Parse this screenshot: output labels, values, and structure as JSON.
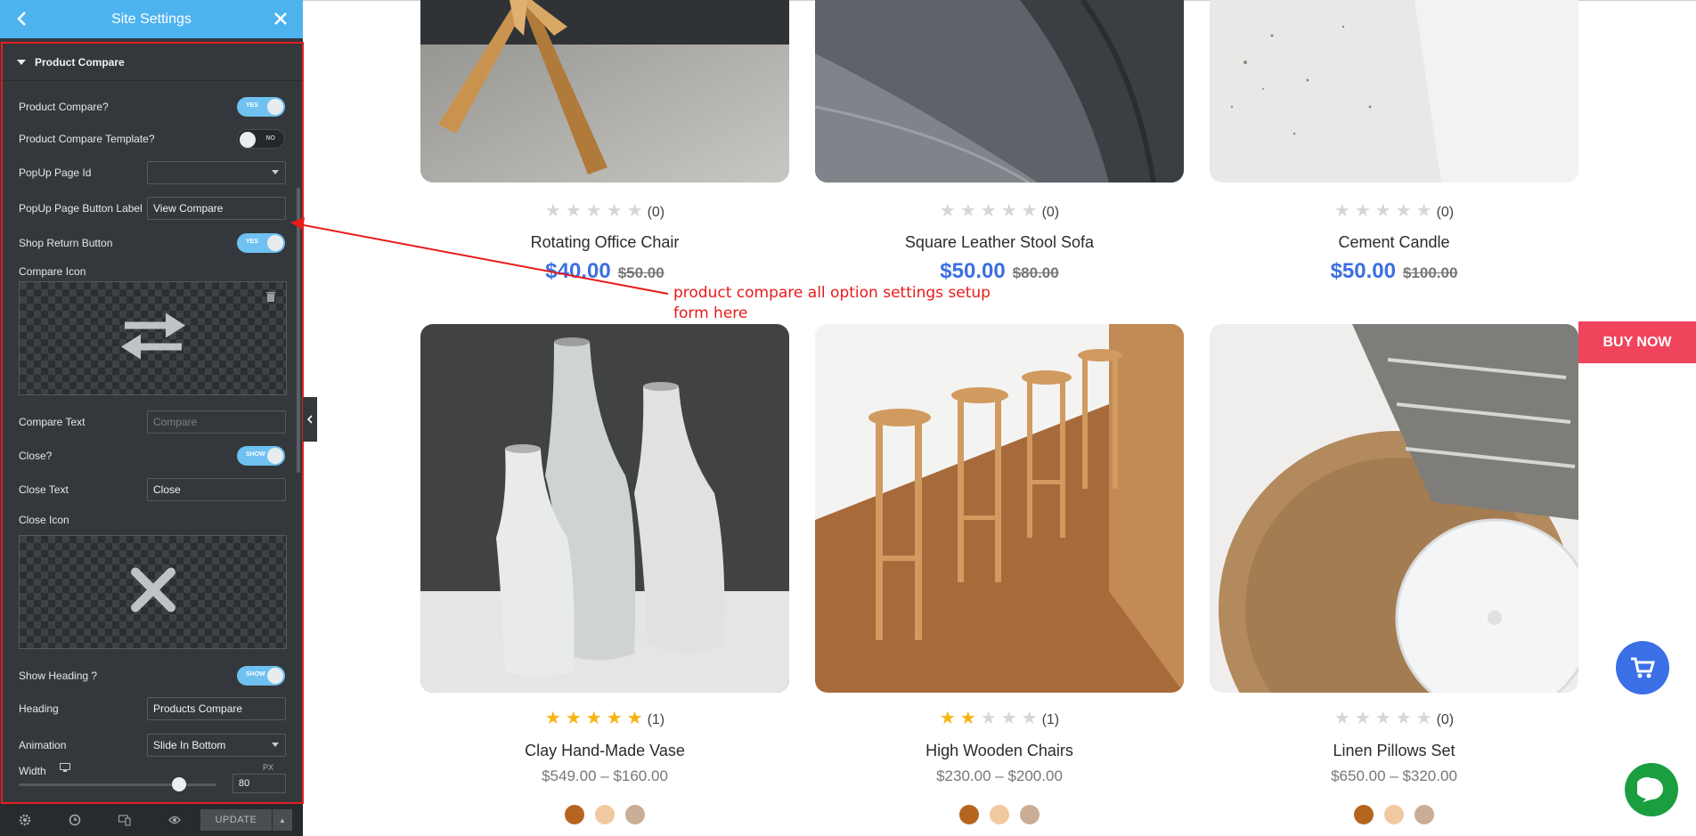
{
  "panel": {
    "title": "Site Settings",
    "section_title": "Product Compare",
    "rows": {
      "product_compare": {
        "label": "Product Compare?",
        "toggle": "YES"
      },
      "compare_template": {
        "label": "Product Compare Template?",
        "toggle": "NO"
      },
      "popup_page_id": {
        "label": "PopUp Page Id",
        "value": ""
      },
      "popup_button_label": {
        "label": "PopUp Page Button Label",
        "value": "View Compare"
      },
      "shop_return": {
        "label": "Shop Return Button",
        "toggle": "YES"
      },
      "compare_icon": {
        "label": "Compare Icon"
      },
      "compare_text": {
        "label": "Compare Text",
        "placeholder": "Compare"
      },
      "close": {
        "label": "Close?",
        "toggle": "SHOW"
      },
      "close_text": {
        "label": "Close Text",
        "value": "Close"
      },
      "close_icon": {
        "label": "Close Icon"
      },
      "show_heading": {
        "label": "Show Heading ?",
        "toggle": "SHOW"
      },
      "heading": {
        "label": "Heading",
        "value": "Products Compare"
      },
      "animation": {
        "label": "Animation",
        "value": "Slide In Bottom"
      },
      "width": {
        "label": "Width",
        "unit": "PX",
        "value": "80"
      }
    },
    "footer": {
      "update_label": "UPDATE"
    }
  },
  "annotation": {
    "text": "product compare all option settings setup form here",
    "color": "#e81a1a"
  },
  "products": [
    {
      "name": "Rotating Office Chair",
      "rating": 0,
      "reviews": "(0)",
      "price": "$40.00",
      "old_price": "$50.00"
    },
    {
      "name": "Square Leather Stool Sofa",
      "rating": 0,
      "reviews": "(0)",
      "price": "$50.00",
      "old_price": "$80.00"
    },
    {
      "name": "Cement Candle",
      "rating": 0,
      "reviews": "(0)",
      "price": "$50.00",
      "old_price": "$100.00"
    },
    {
      "name": "Clay Hand-Made Vase",
      "rating": 5,
      "reviews": "(1)",
      "price_range": "$549.00 – $160.00",
      "swatches": [
        "#b5651d",
        "#f1c9a0",
        "#c9ad96"
      ]
    },
    {
      "name": "High Wooden Chairs",
      "rating": 2,
      "reviews": "(1)",
      "price_range": "$230.00 – $200.00",
      "swatches": [
        "#b5651d",
        "#f1c9a0",
        "#c9ad96"
      ]
    },
    {
      "name": "Linen Pillows Set",
      "rating": 0,
      "reviews": "(0)",
      "price_range": "$650.00 – $320.00",
      "swatches": [
        "#b5651d",
        "#f1c9a0",
        "#c9ad96"
      ]
    }
  ],
  "buy_now": "BUY NOW",
  "colors": {
    "accent_blue": "#4db3ef",
    "price_blue": "#3c6fe0",
    "buy_now": "#f0435c",
    "chat_green": "#1a9e40"
  },
  "icons": [
    "chevron-left-icon",
    "close-icon",
    "compare-arrows-icon",
    "x-icon",
    "trash-icon",
    "gear-icon",
    "history-icon",
    "responsive-icon",
    "eye-icon",
    "cart-icon",
    "chat-icon",
    "monitor-icon"
  ]
}
